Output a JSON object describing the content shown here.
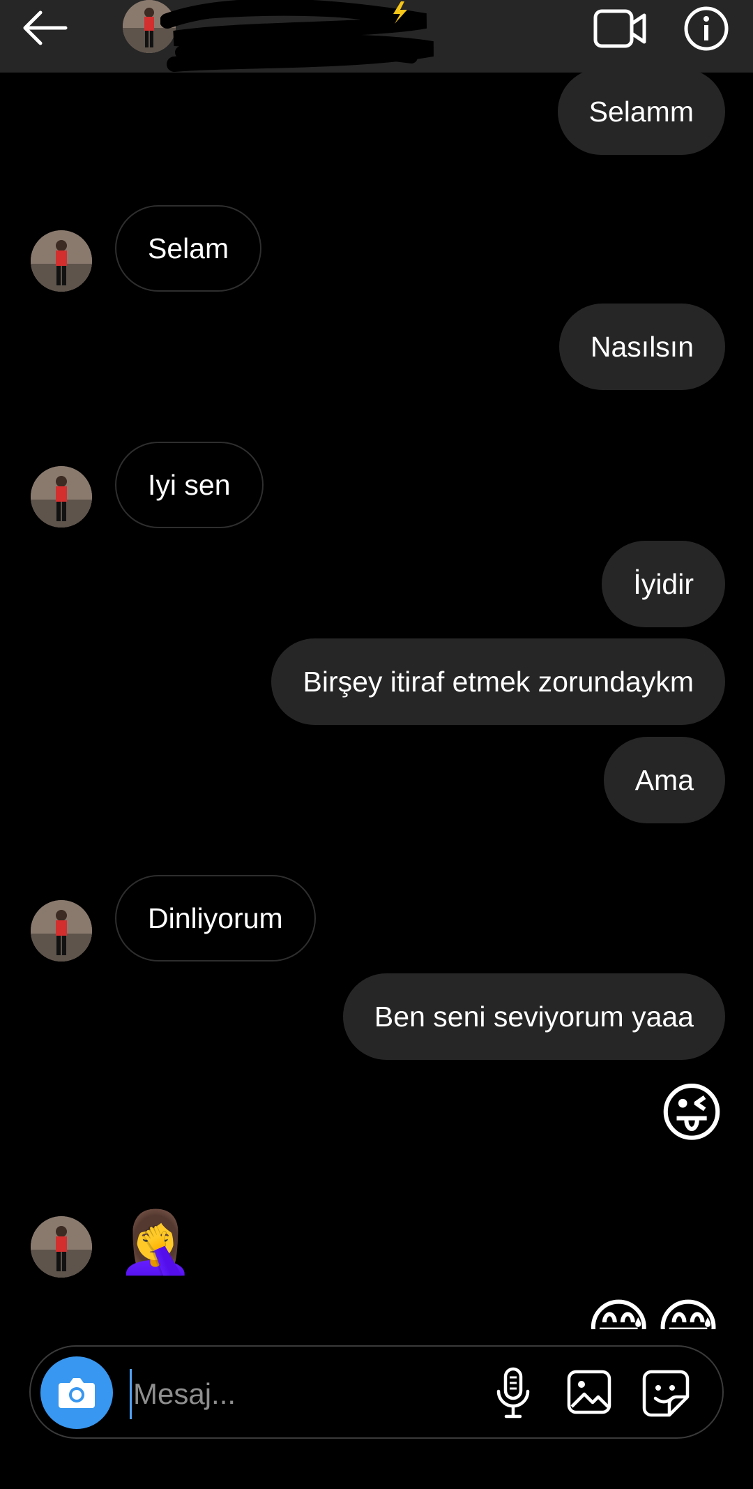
{
  "header": {
    "back": "back-arrow-icon",
    "video": "video-camera-icon",
    "info": "info-icon"
  },
  "messages": {
    "m1": "Selamm",
    "m2": "Selam",
    "m3": "Nasılsın",
    "m4": "Iyi sen",
    "m5": "İyidir",
    "m6": "Birşey itiraf etmek zorundaykm",
    "m7": "Ama",
    "m8": "Dinliyorum",
    "m9": "Ben seni seviyorum yaaa",
    "e1": "😜",
    "e2": "🤦‍♀️",
    "e3": "😅😅"
  },
  "composer": {
    "placeholder": "Mesaj...",
    "camera": "camera-icon",
    "mic": "microphone-icon",
    "gallery": "gallery-icon",
    "sticker": "sticker-icon"
  },
  "colors": {
    "background": "#000000",
    "header": "#262626",
    "outgoing_bubble": "#262626",
    "camera_button": "#3897f0"
  }
}
